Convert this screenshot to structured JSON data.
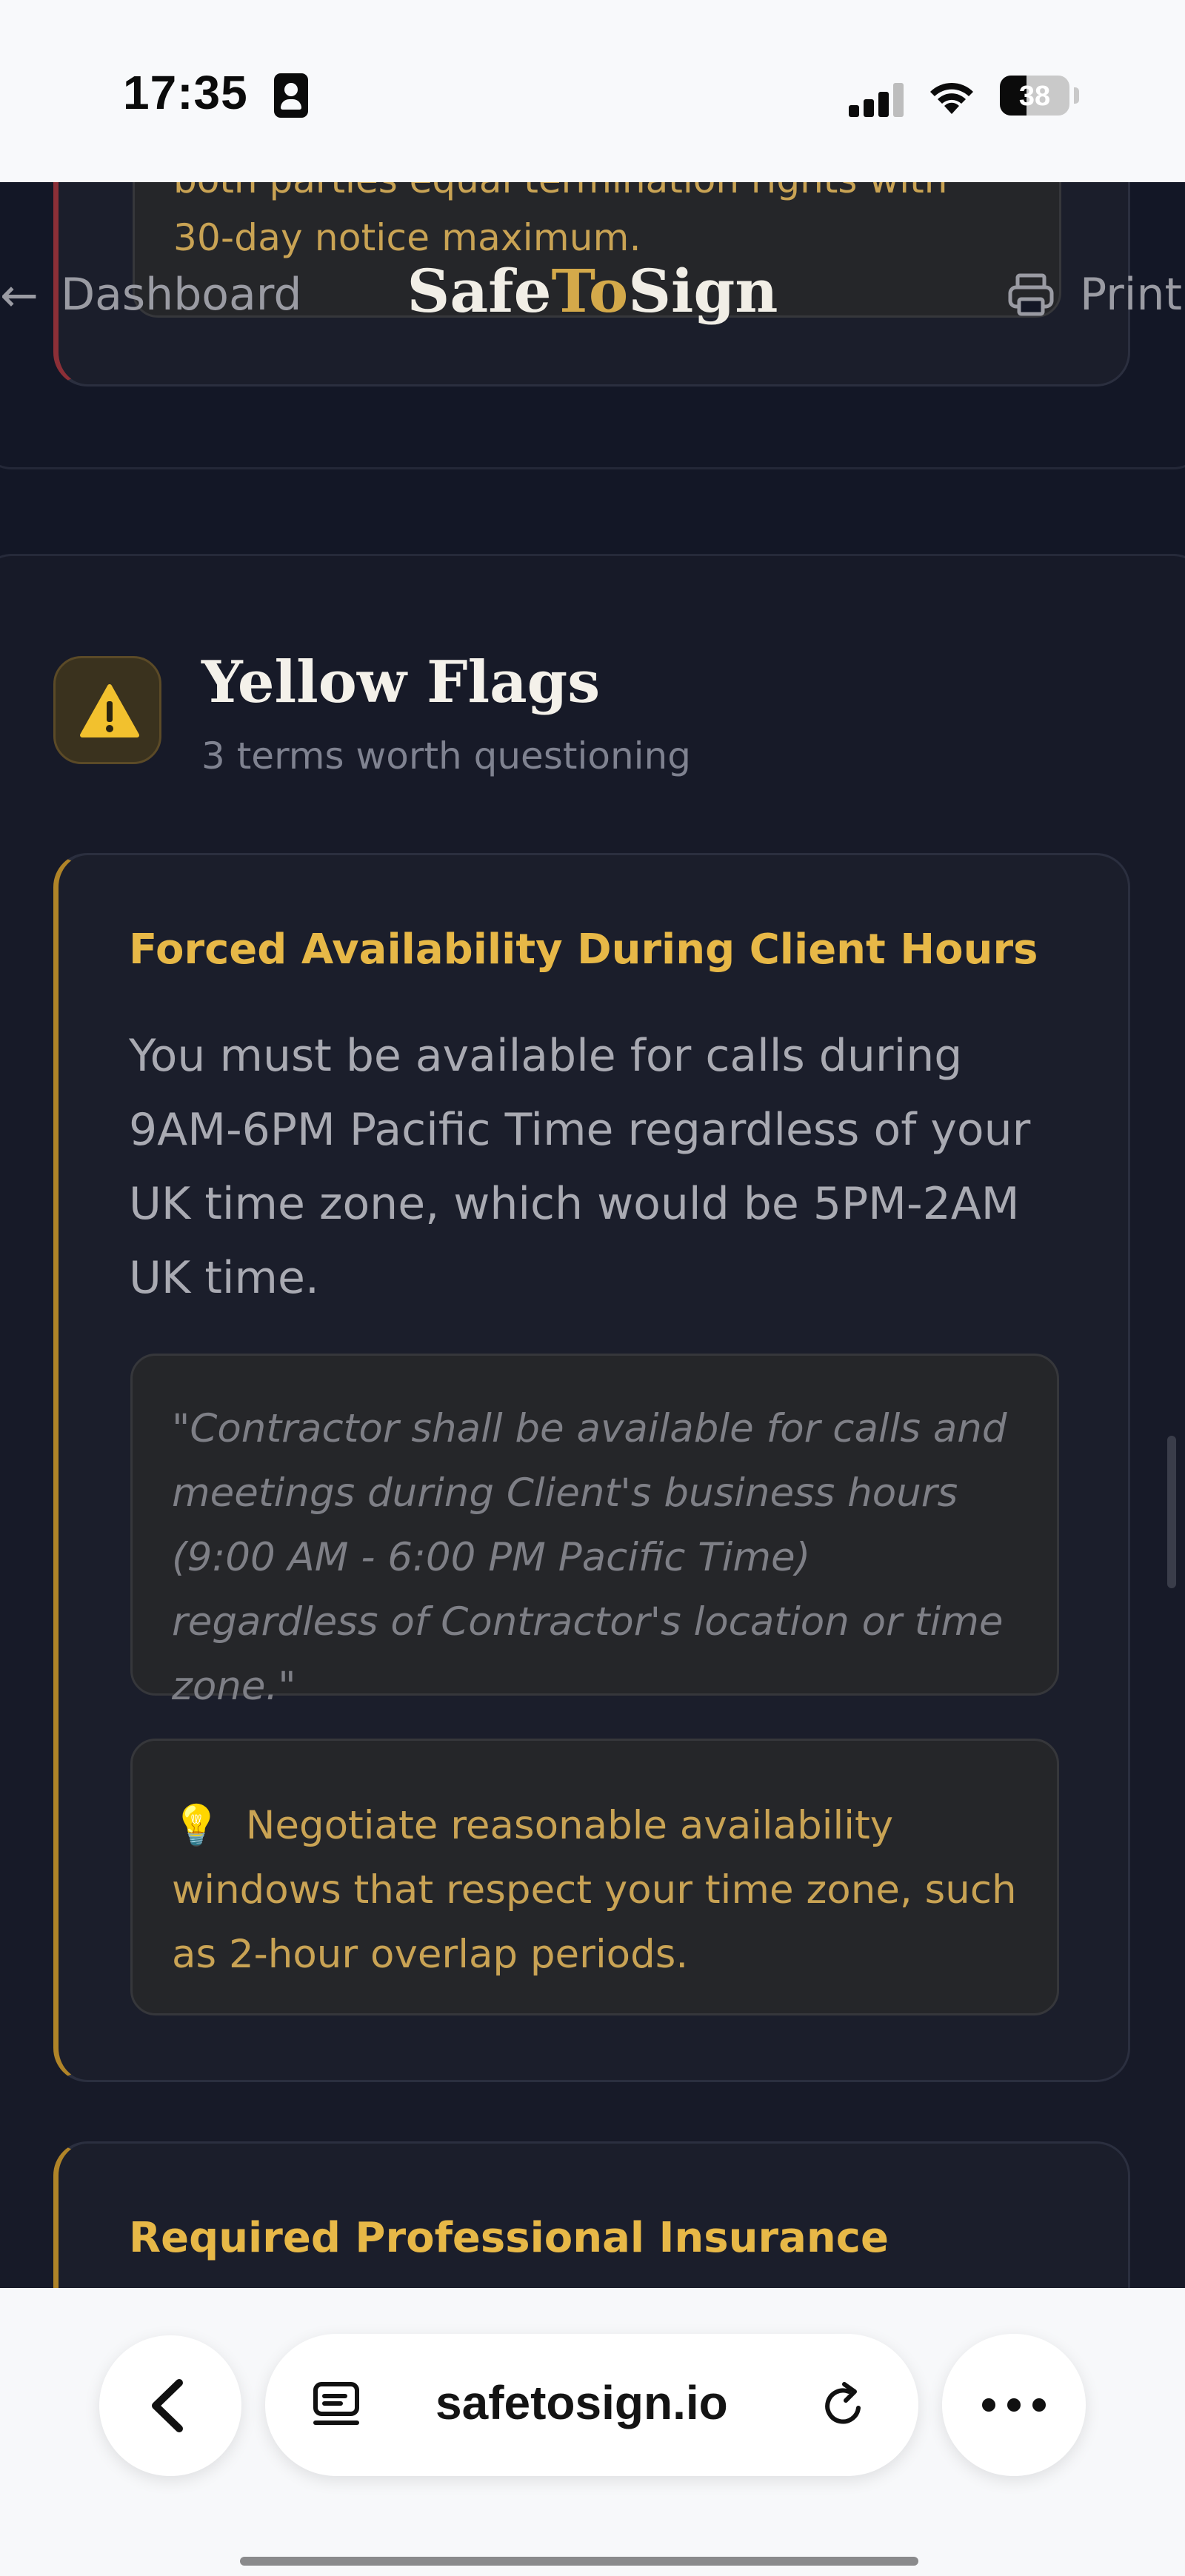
{
  "status_bar": {
    "time": "17:35",
    "battery_level": "38",
    "icons": [
      "contact-card-icon",
      "cellular-signal-icon",
      "wifi-icon",
      "battery-icon"
    ]
  },
  "nav": {
    "back_label": "Dashboard",
    "brand_part1": "Safe",
    "brand_part2": "To",
    "brand_part3": "Sign",
    "print_label": "Print"
  },
  "previous_flag": {
    "partial_text_cut": "both parties equal termination rights with",
    "partial_text": "30-day notice maximum."
  },
  "yellow_flags": {
    "title": "Yellow Flags",
    "subtitle": "3 terms worth questioning",
    "items": [
      {
        "title": "Forced Availability During Client Hours",
        "description": "You must be available for calls during 9AM-6PM Pacific Time regardless of your UK time zone, which would be 5PM-2AM UK time.",
        "quote": "\"Contractor shall be available for calls and meetings during Client's business hours (9:00 AM - 6:00 PM Pacific Time) regardless of Contractor's location or time zone.\"",
        "tip_icon": "💡",
        "tip": "Negotiate reasonable availability windows that respect your time zone, such as 2-hour overlap periods."
      },
      {
        "title": "Required Professional Insurance"
      }
    ]
  },
  "browser": {
    "url": "safetosign.io"
  },
  "colors": {
    "background": "#131726",
    "card": "#1b1e2b",
    "gold_accent": "#e7b847",
    "red_accent": "#8b2f37"
  }
}
